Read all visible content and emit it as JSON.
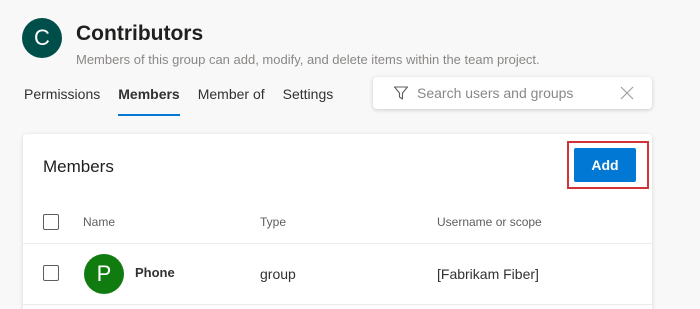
{
  "header": {
    "avatar_letter": "C",
    "title": "Contributors",
    "subtitle": "Members of this group can add, modify, and delete items within the team project."
  },
  "tabs": [
    {
      "label": "Permissions",
      "active": false
    },
    {
      "label": "Members",
      "active": true
    },
    {
      "label": "Member of",
      "active": false
    },
    {
      "label": "Settings",
      "active": false
    }
  ],
  "search": {
    "placeholder": "Search users and groups",
    "value": ""
  },
  "members_panel": {
    "title": "Members",
    "add_label": "Add",
    "columns": [
      "Name",
      "Type",
      "Username or scope"
    ],
    "rows": [
      {
        "avatar_letter": "P",
        "name": "Phone",
        "type": "group",
        "scope": "[Fabrikam Fiber]"
      }
    ]
  },
  "colors": {
    "accent": "#0078d4",
    "group_avatar": "#004e4a",
    "row_avatar": "#107c10",
    "highlight": "#d13438"
  },
  "icons": [
    "filter-icon",
    "close-icon"
  ]
}
